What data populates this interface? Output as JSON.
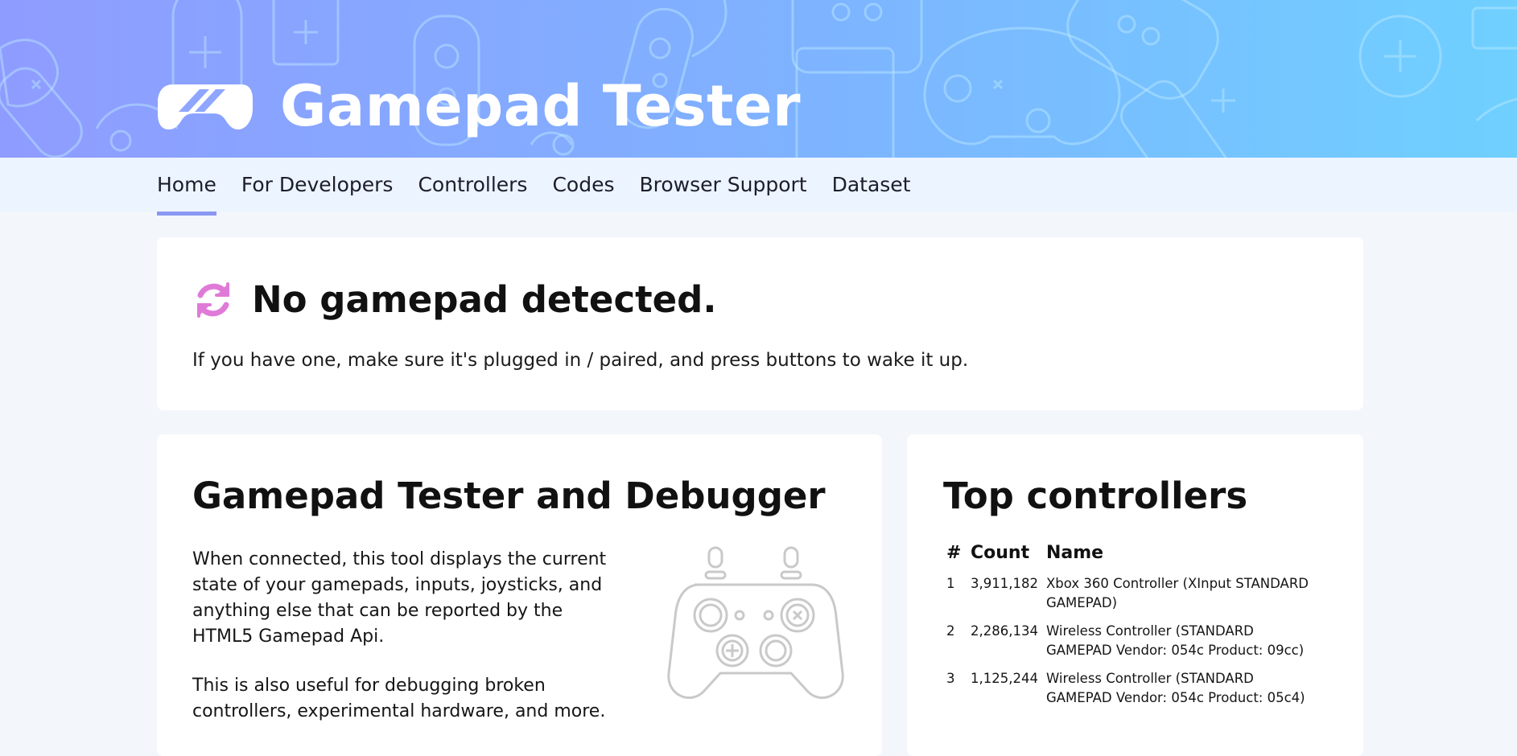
{
  "header": {
    "site_title": "Gamepad Tester",
    "logo": "gamepad-logo-icon"
  },
  "nav": {
    "items": [
      "Home",
      "For Developers",
      "Controllers",
      "Codes",
      "Browser Support",
      "Dataset"
    ],
    "active": "Home"
  },
  "status": {
    "icon": "refresh-icon",
    "title": "No gamepad detected.",
    "text": "If you have one, make sure it's plugged in / paired, and press buttons to wake it up."
  },
  "about": {
    "title": "Gamepad Tester and Debugger",
    "paragraph1": "When connected, this tool displays the current state of your gamepads, inputs, joysticks, and anything else that can be reported by the HTML5 Gamepad Api.",
    "paragraph2": "This is also useful for debugging broken controllers, experimental hardware, and more.",
    "illustration": "gamepad-outline-icon"
  },
  "top_controllers": {
    "title": "Top controllers",
    "columns": [
      "#",
      "Count",
      "Name"
    ],
    "rows": [
      {
        "rank": "1",
        "count": "3,911,182",
        "name": "Xbox 360 Controller (XInput STANDARD GAMEPAD)"
      },
      {
        "rank": "2",
        "count": "2,286,134",
        "name": "Wireless Controller (STANDARD GAMEPAD Vendor: 054c Product: 09cc)"
      },
      {
        "rank": "3",
        "count": "1,125,244",
        "name": "Wireless Controller (STANDARD GAMEPAD Vendor: 054c Product: 05c4)"
      }
    ]
  },
  "colors": {
    "accent": "#8a98f2",
    "refresh_icon": "#e07ad8",
    "hero_start": "#8f9cff",
    "hero_end": "#6fd0ff"
  }
}
